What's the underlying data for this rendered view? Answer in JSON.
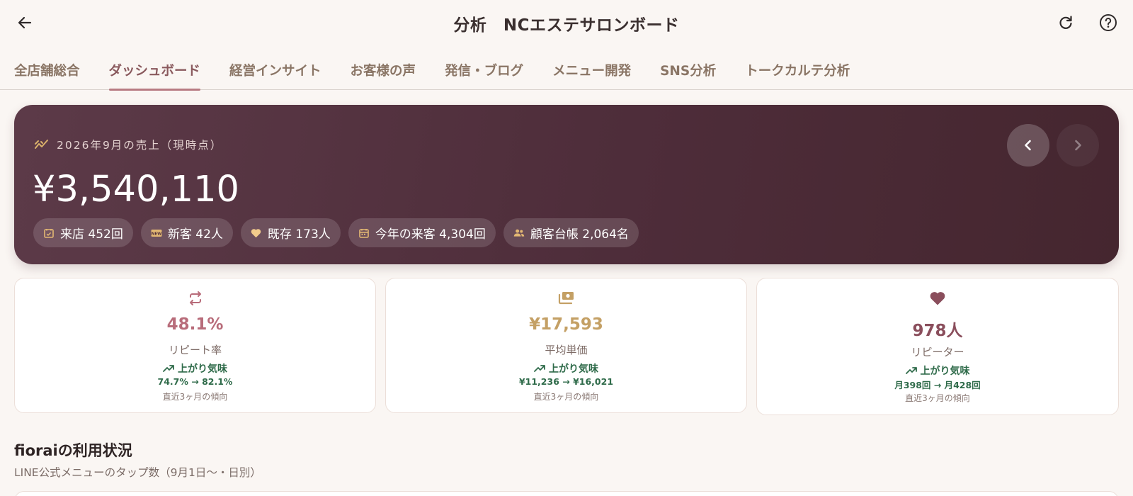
{
  "header": {
    "title": "分析　NCエステサロンボード"
  },
  "tabs": [
    {
      "label": "全店舗総合"
    },
    {
      "label": "ダッシュボード",
      "active": true
    },
    {
      "label": "経営インサイト"
    },
    {
      "label": "お客様の声"
    },
    {
      "label": "発信・ブログ"
    },
    {
      "label": "メニュー開発"
    },
    {
      "label": "SNS分析"
    },
    {
      "label": "トークカルテ分析"
    }
  ],
  "hero": {
    "label": "2026年9月の売上（現時点）",
    "amount": "¥3,540,110",
    "chips": [
      {
        "icon": "calendar-check-icon",
        "text": "来店 452回"
      },
      {
        "icon": "new-badge-icon",
        "text": "新客 42人"
      },
      {
        "icon": "heart-icon",
        "text": "既存 173人"
      },
      {
        "icon": "calendar-icon",
        "text": "今年の来客 4,304回"
      },
      {
        "icon": "people-icon",
        "text": "顧客台帳 2,064名"
      }
    ]
  },
  "stats": [
    {
      "icon": "repeat-icon",
      "value": "48.1%",
      "name": "リピート率",
      "trend": "上がり気味",
      "range": "74.7% → 82.1%",
      "note": "直近3ヶ月の傾向",
      "color": "#b86c7a"
    },
    {
      "icon": "money-icon",
      "value": "¥17,593",
      "name": "平均単価",
      "trend": "上がり気味",
      "range": "¥11,236 → ¥16,021",
      "note": "直近3ヶ月の傾向",
      "color": "#c4a065"
    },
    {
      "icon": "heart-icon",
      "value": "978人",
      "name": "リピーター",
      "trend": "上がり気味",
      "range": "月398回 → 月428回",
      "note": "直近3ヶ月の傾向",
      "color": "#8a4e5c"
    }
  ],
  "section": {
    "title": "fioraiの利用状況",
    "subtitle": "LINE公式メニューのタップ数（9月1日〜・日別）"
  },
  "colors": {
    "background": "#faf6f3",
    "hero": "#4e2d3a",
    "accent": "#b87b82",
    "trend": "#2f6b4a"
  }
}
